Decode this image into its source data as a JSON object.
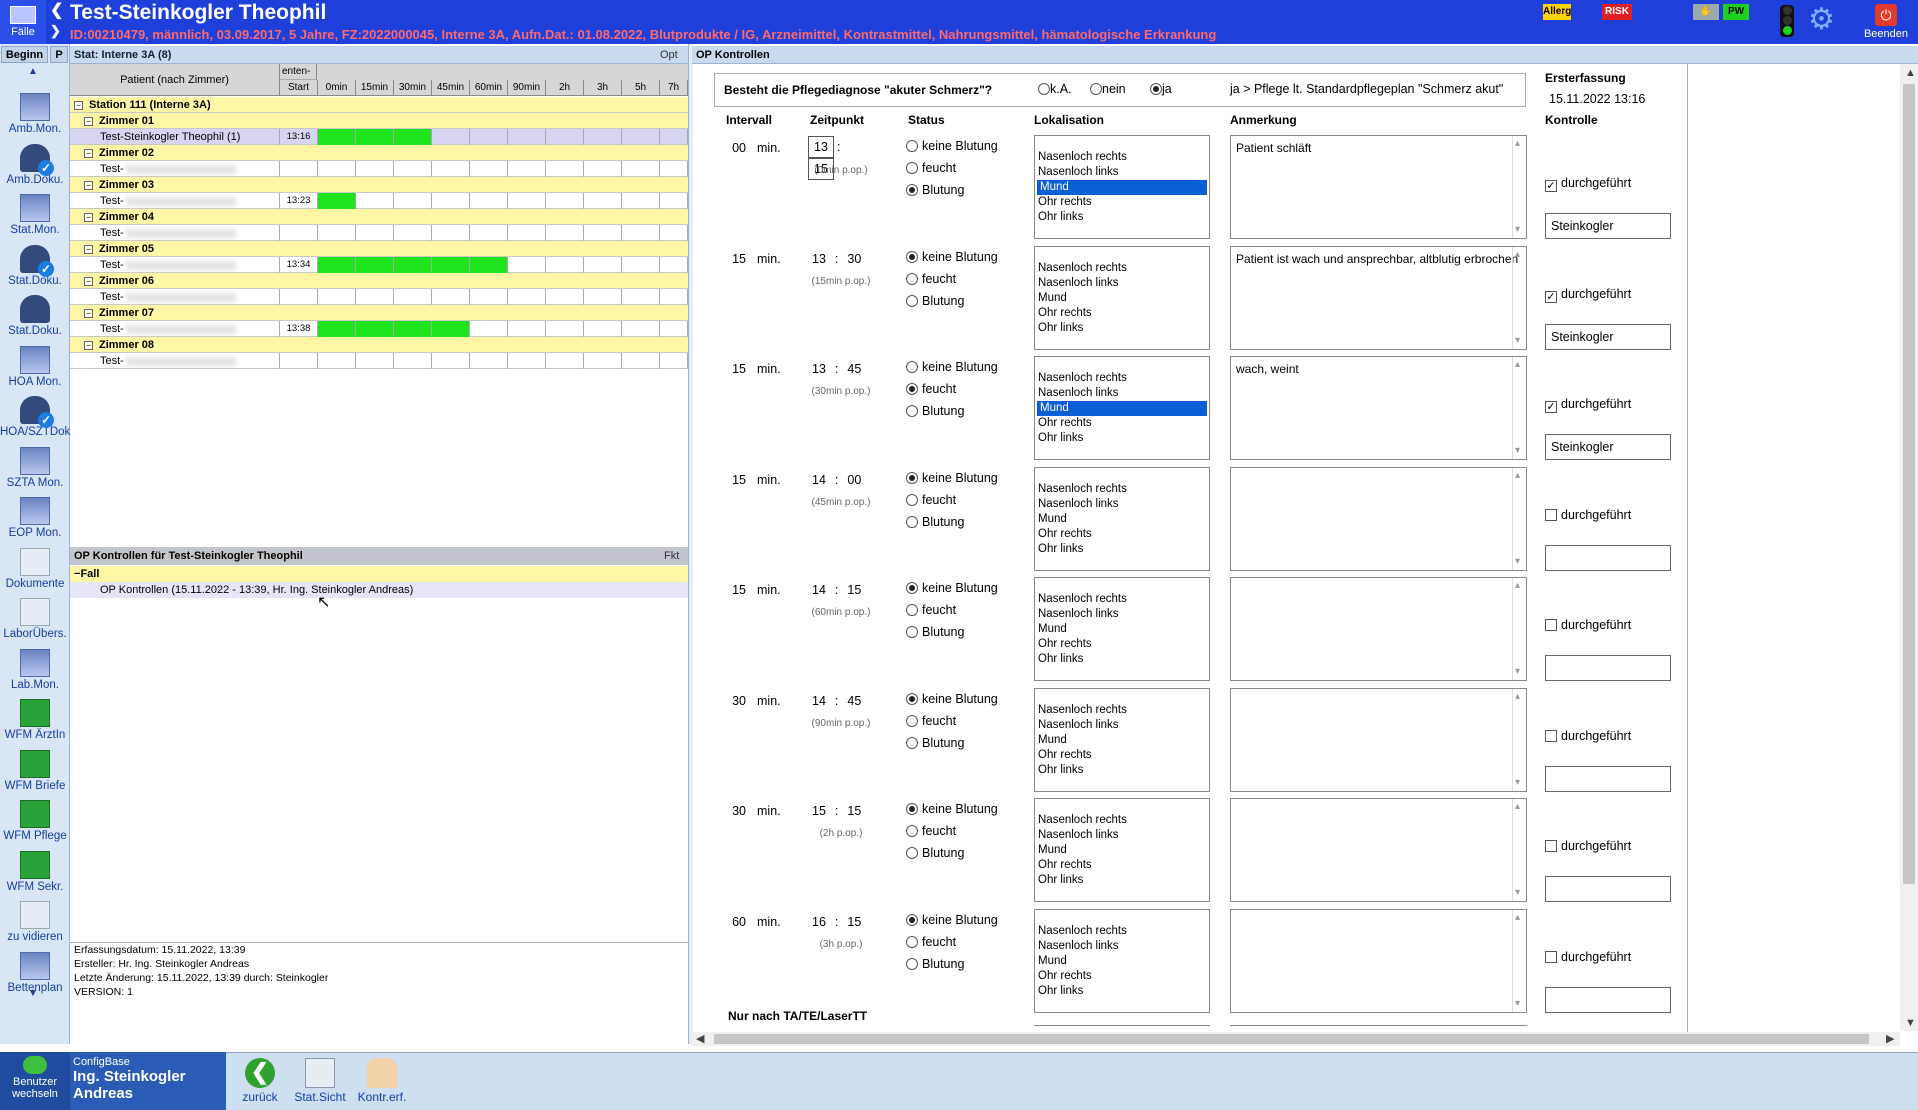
{
  "header": {
    "falle_label": "Fälle",
    "title": "Test-Steinkogler Theophil",
    "info": "ID:00210479, männlich, 03.09.2017, 5 Jahre, FZ:2022000045, Interne 3A, Aufn.Dat.: 01.08.2022, Blutprodukte / IG, Arzneimittel, Kontrastmittel, Nahrungsmittel, hämatologische Erkrankung",
    "allerg": "Allerg",
    "risk": "RISK",
    "pw": "PW",
    "beenden": "Beenden"
  },
  "left_toolbar": {
    "tab_begin": "Beginn",
    "tab_p": "P",
    "items": [
      "Amb.Mon.",
      "Amb.Doku.",
      "Stat.Mon.",
      "Stat.Doku.",
      "Stat.Doku.",
      "HOA Mon.",
      "HOA/SZTDok",
      "SZTA Mon.",
      "EOP Mon.",
      "Dokumente",
      "LaborÜbers.",
      "Lab.Mon.",
      "WFM ÄrztIn",
      "WFM Briefe",
      "WFM Pflege",
      "WFM Sekr.",
      "zu vidieren",
      "Bettenplan"
    ]
  },
  "station": {
    "header": "Stat: Interne 3A (8)",
    "opt": "Opt",
    "col_patient": "Patient (nach Zimmer)",
    "col_enten": "enten-",
    "cols": [
      "Start",
      "0min",
      "15min",
      "30min",
      "45min",
      "60min",
      "90min",
      "2h",
      "3h",
      "5h",
      "7h"
    ],
    "station_row": "Station 111 (Interne 3A)",
    "rooms": [
      {
        "name": "Zimmer 01",
        "patient": "Test-Steinkogler Theophil (1)",
        "start": "13:16",
        "filled": 3,
        "selected": true
      },
      {
        "name": "Zimmer 02",
        "patient": "Test-",
        "start": "",
        "filled": 0,
        "selected": false
      },
      {
        "name": "Zimmer 03",
        "patient": "Test-",
        "start": "13:23",
        "filled": 1,
        "selected": false
      },
      {
        "name": "Zimmer 04",
        "patient": "Test-",
        "start": "",
        "filled": 0,
        "selected": false
      },
      {
        "name": "Zimmer 05",
        "patient": "Test-",
        "start": "13:34",
        "filled": 5,
        "selected": false
      },
      {
        "name": "Zimmer 06",
        "patient": "Test-",
        "start": "",
        "filled": 0,
        "selected": false
      },
      {
        "name": "Zimmer 07",
        "patient": "Test-",
        "start": "13:38",
        "filled": 4,
        "selected": false
      },
      {
        "name": "Zimmer 08",
        "patient": "Test-",
        "start": "",
        "filled": 0,
        "selected": false
      }
    ]
  },
  "fkt": {
    "header": "OP Kontrollen für Test-Steinkogler Theophil",
    "fkt": "Fkt",
    "fall": "Fall",
    "item": "OP Kontrollen (15.11.2022 - 13:39, Hr. Ing. Steinkogler Andreas)"
  },
  "meta": {
    "erfassung": "Erfassungsdatum: 15.11.2022, 13:39",
    "ersteller": "Ersteller: Hr. Ing. Steinkogler Andreas",
    "aenderung": "Letzte Änderung: 15.11.2022, 13:39 durch: Steinkogler",
    "version": "VERSION: 1"
  },
  "op": {
    "header": "OP Kontrollen",
    "frage": "Besteht die Pflegediagnose \"akuter Schmerz\"?",
    "frage_opts": [
      "k.A.",
      "nein",
      "ja"
    ],
    "frage_selected": 2,
    "frage_hint": "ja > Pflege lt. Standardpflegeplan \"Schmerz akut\"",
    "erst_label": "Ersterfassung",
    "erst_value": "15.11.2022   13:16",
    "col_intervall": "Intervall",
    "col_zeitpunkt": "Zeitpunkt",
    "col_status": "Status",
    "col_lok": "Lokalisation",
    "col_anm": "Anmerkung",
    "col_kontrolle": "Kontrolle",
    "min_label": "min.",
    "status_opts": [
      "keine Blutung",
      "feucht",
      "Blutung"
    ],
    "lok_opts": [
      "Nasenloch rechts",
      "Nasenloch links",
      "Mund",
      "Ohr rechts",
      "Ohr links"
    ],
    "kontr_label": "durchgeführt",
    "nur_label": "Nur nach TA/TE/LaserTT",
    "rows": [
      {
        "int": "00",
        "hh": "13",
        "mm": "15",
        "sub": "(0min p.op.)",
        "status": 2,
        "lok_sel": 2,
        "anm": "Patient schläft",
        "done": true,
        "name": "Steinkogler",
        "edit": true
      },
      {
        "int": "15",
        "hh": "13",
        "mm": "30",
        "sub": "(15min p.op.)",
        "status": 0,
        "lok_sel": -1,
        "anm": "Patient ist wach und ansprechbar, altblutig erbrochen",
        "done": true,
        "name": "Steinkogler",
        "edit": false
      },
      {
        "int": "15",
        "hh": "13",
        "mm": "45",
        "sub": "(30min p.op.)",
        "status": 1,
        "lok_sel": 2,
        "anm": "wach, weint",
        "done": true,
        "name": "Steinkogler",
        "edit": false
      },
      {
        "int": "15",
        "hh": "14",
        "mm": "00",
        "sub": "(45min p.op.)",
        "status": 0,
        "lok_sel": -1,
        "anm": "",
        "done": false,
        "name": "",
        "edit": false
      },
      {
        "int": "15",
        "hh": "14",
        "mm": "15",
        "sub": "(60min p.op.)",
        "status": 0,
        "lok_sel": -1,
        "anm": "",
        "done": false,
        "name": "",
        "edit": false
      },
      {
        "int": "30",
        "hh": "14",
        "mm": "45",
        "sub": "(90min p.op.)",
        "status": 0,
        "lok_sel": -1,
        "anm": "",
        "done": false,
        "name": "",
        "edit": false
      },
      {
        "int": "30",
        "hh": "15",
        "mm": "15",
        "sub": "(2h p.op.)",
        "status": 0,
        "lok_sel": -1,
        "anm": "",
        "done": false,
        "name": "",
        "edit": false
      },
      {
        "int": "60",
        "hh": "16",
        "mm": "15",
        "sub": "(3h p.op.)",
        "status": 0,
        "lok_sel": -1,
        "anm": "",
        "done": false,
        "name": "",
        "edit": false
      }
    ]
  },
  "bottom": {
    "user_switch": "Benutzer wechseln",
    "cfg": "ConfigBase",
    "user_name": "Ing. Steinkogler Andreas",
    "btn_back": "zurück",
    "btn_statsicht": "Stat.Sicht",
    "btn_kontr": "Kontr.erf."
  }
}
